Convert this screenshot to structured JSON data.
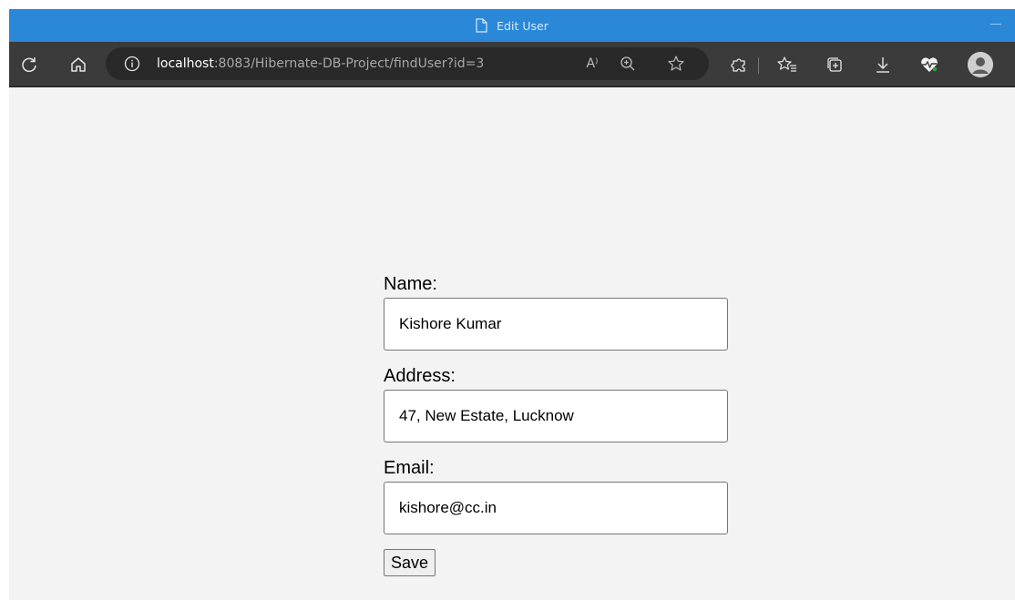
{
  "window": {
    "title": "Edit User"
  },
  "browser": {
    "url_host": "localhost",
    "url_rest": ":8083/Hibernate-DB-Project/findUser?id=3",
    "read_aloud_label": "A⁾"
  },
  "form": {
    "name_label": "Name:",
    "name_value": "Kishore Kumar",
    "address_label": "Address:",
    "address_value": "47, New Estate, Lucknow",
    "email_label": "Email:",
    "email_value": "kishore@cc.in",
    "save_label": "Save"
  },
  "colors": {
    "titlebar": "#2b88d8",
    "toolbar": "#3b3b3b",
    "addressbar": "#292929",
    "page_background": "#f3f3f3"
  }
}
